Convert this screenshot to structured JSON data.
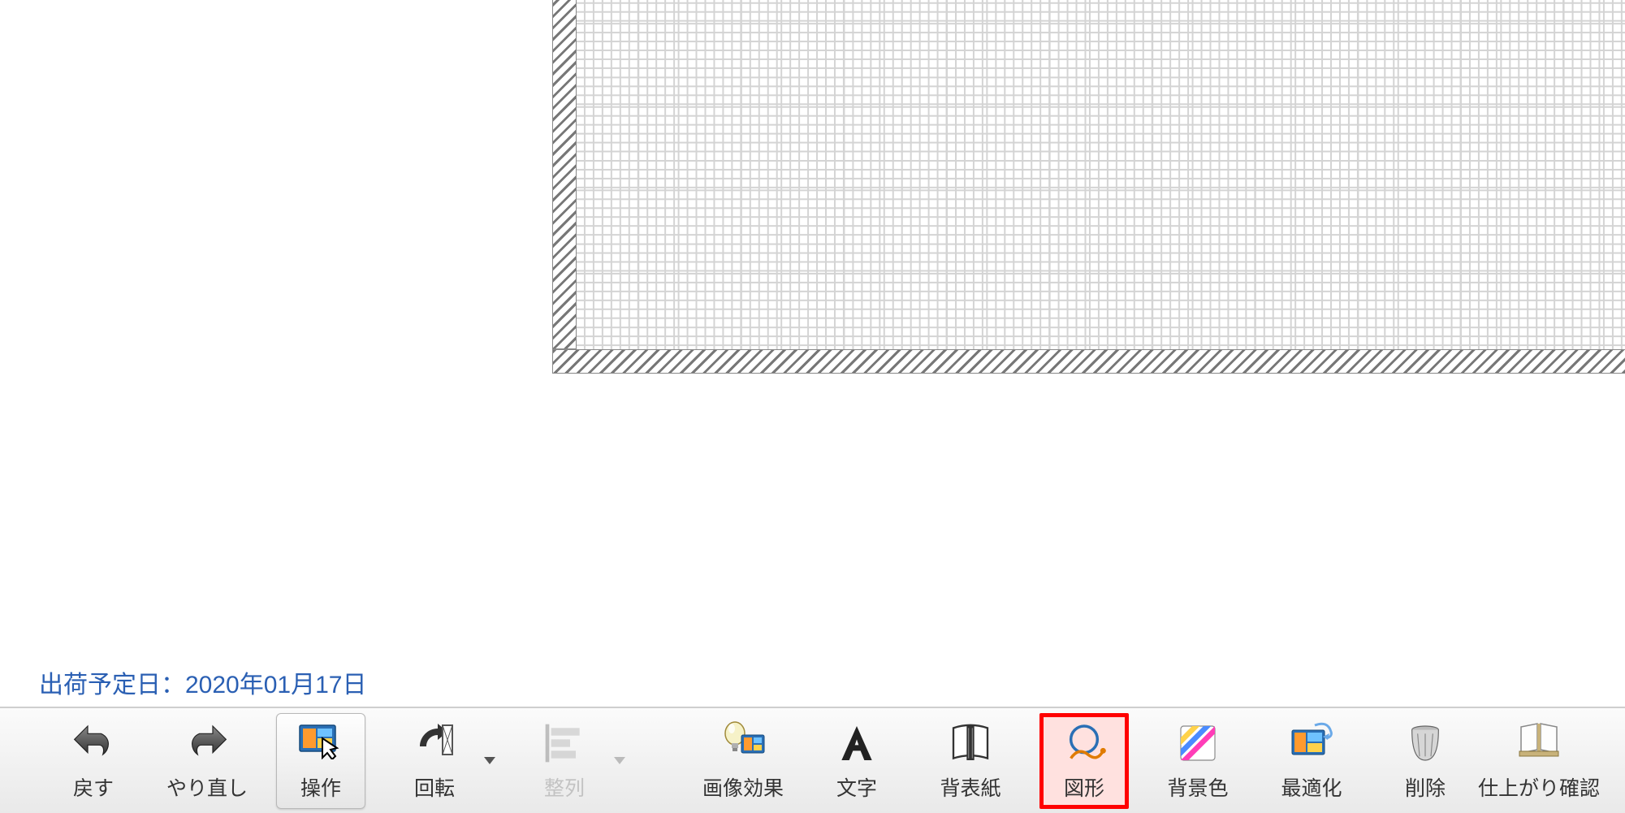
{
  "status": {
    "shipping_label": "出荷予定日：2020年01月17日"
  },
  "toolbar": {
    "undo": "戻す",
    "redo": "やり直し",
    "operate": "操作",
    "rotate": "回転",
    "align": "整列",
    "image_effect": "画像効果",
    "text": "文字",
    "cover": "背表紙",
    "shape": "図形",
    "bgcolor": "背景色",
    "optimize": "最適化",
    "delete": "削除",
    "preview": "仕上がり確認"
  },
  "highlighted_tool": "shape"
}
